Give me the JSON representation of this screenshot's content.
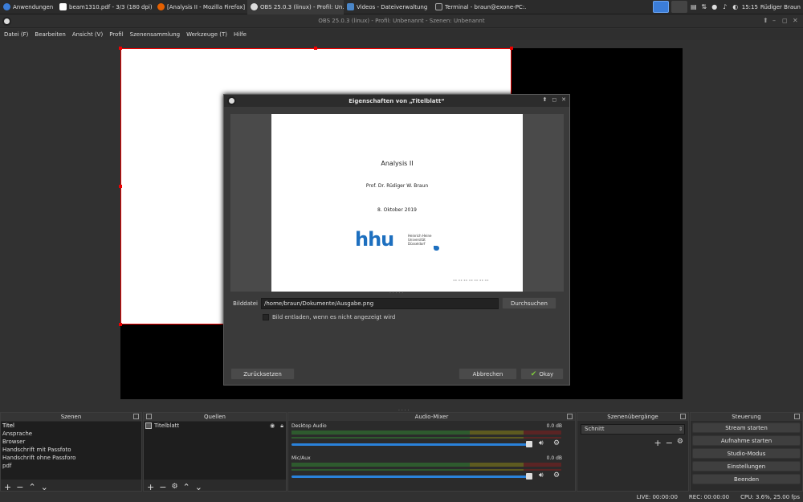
{
  "taskbar": {
    "items": [
      {
        "label": "Anwendungen",
        "color": "#3b7dd8"
      },
      {
        "label": "beam1310.pdf - 3/3 (180 dpi)",
        "color": "#ffffff"
      },
      {
        "label": "[Analysis II - Mozilla Firefox]",
        "color": "#e66000"
      },
      {
        "label": "OBS 25.0.3 (linux) - Profil: Un...",
        "color": "#dddddd"
      },
      {
        "label": "Videos - Dateiverwaltung",
        "color": "#4a86c8"
      },
      {
        "label": "Terminal - braun@exone-PC:...",
        "color": "#333333"
      }
    ],
    "time": "15:15",
    "user": "Rüdiger Braun"
  },
  "window": {
    "title": "OBS 25.0.3 (linux) - Profil: Unbenannt - Szenen: Unbenannt"
  },
  "menu": [
    "Datei (F)",
    "Bearbeiten",
    "Ansicht (V)",
    "Profil",
    "Szenensammlung",
    "Werkzeuge (T)",
    "Hilfe"
  ],
  "dialog": {
    "title": "Eigenschaften von „Titelblatt“",
    "slide": {
      "title": "Analysis II",
      "author": "Prof. Dr. Rüdiger W. Braun",
      "date": "8. Oktober 2019",
      "logo_text": "hhu",
      "logo_lines": [
        "Heinrich Heine",
        "Universität",
        "Düsseldorf"
      ]
    },
    "file_label": "Bilddatei",
    "file_value": "/home/braun/Dokumente/Ausgabe.png",
    "browse_label": "Durchsuchen",
    "unload_label": "Bild entladen, wenn es nicht angezeigt wird",
    "reset_label": "Zurücksetzen",
    "cancel_label": "Abbrechen",
    "ok_label": "Okay"
  },
  "docks": {
    "scenes": {
      "title": "Szenen",
      "items": [
        "Titel",
        "Ansprache",
        "Browser",
        "Handschrift mit Passfoto",
        "Handschrift ohne Passforo",
        "pdf"
      ]
    },
    "sources": {
      "title": "Quellen",
      "items": [
        "Titelblatt"
      ]
    },
    "mixer": {
      "title": "Audio-Mixer",
      "channels": [
        {
          "name": "Desktop Audio",
          "db": "0.0 dB"
        },
        {
          "name": "Mic/Aux",
          "db": "0.0 dB"
        }
      ]
    },
    "transitions": {
      "title": "Szenenübergänge",
      "selected": "Schnitt"
    },
    "controls": {
      "title": "Steuerung",
      "buttons": [
        "Stream starten",
        "Aufnahme starten",
        "Studio-Modus",
        "Einstellungen",
        "Beenden"
      ]
    }
  },
  "status": {
    "live": "LIVE: 00:00:00",
    "rec": "REC: 00:00:00",
    "cpu": "CPU: 3.6%, 25.00 fps"
  }
}
